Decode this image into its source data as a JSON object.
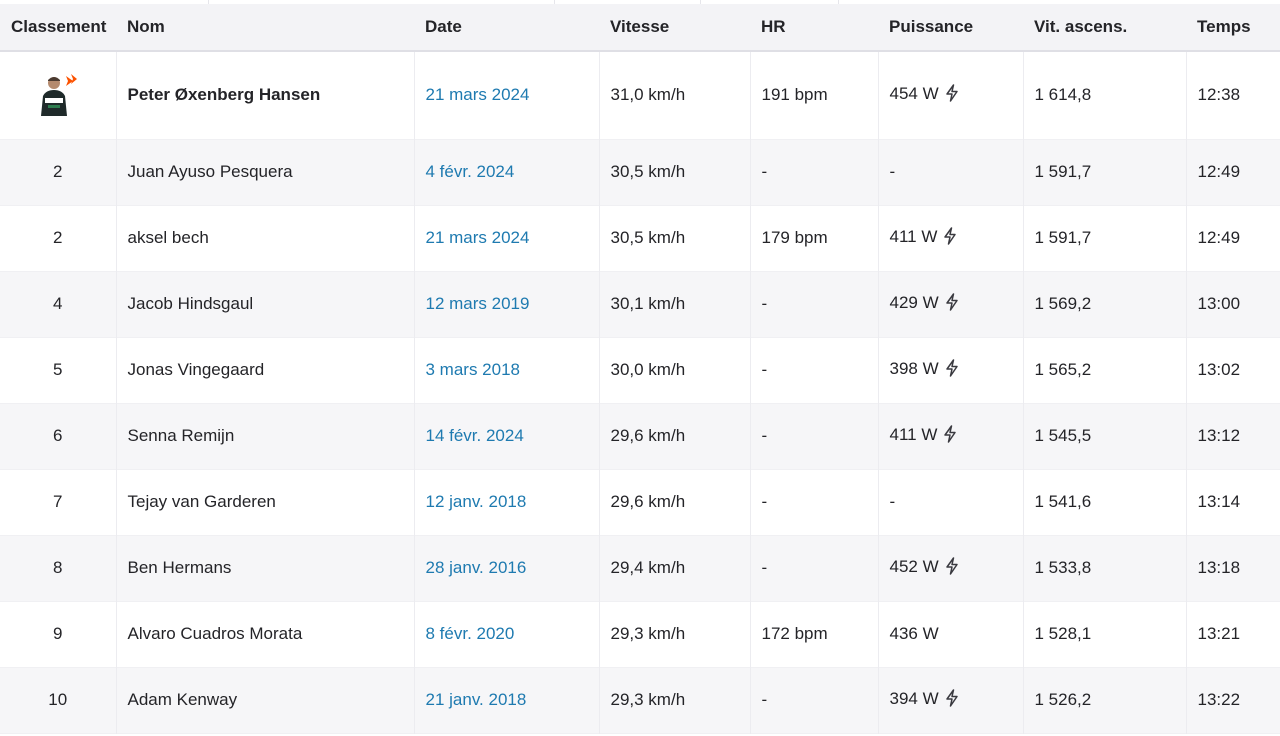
{
  "colors": {
    "date_link": "#1e7ab0",
    "header_bg": "#f3f3f6",
    "stripe_bg": "#f6f6f8",
    "brand": "#fc5200"
  },
  "columns": {
    "rank": "Classement",
    "name": "Nom",
    "date": "Date",
    "speed": "Vitesse",
    "hr": "HR",
    "power": "Puissance",
    "vam": "Vit. ascens.",
    "time": "Temps"
  },
  "rows": [
    {
      "rank": "",
      "avatar": true,
      "name": "Peter Øxenberg Hansen",
      "date": "21 mars 2024",
      "speed": "31,0 km/h",
      "hr": "191 bpm",
      "power": "454 W",
      "power_meter": true,
      "vam": "1 614,8",
      "time": "12:38"
    },
    {
      "rank": "2",
      "name": "Juan Ayuso Pesquera",
      "date": "4 févr. 2024",
      "speed": "30,5 km/h",
      "hr": "-",
      "power": "-",
      "power_meter": false,
      "vam": "1 591,7",
      "time": "12:49"
    },
    {
      "rank": "2",
      "name": "aksel bech",
      "date": "21 mars 2024",
      "speed": "30,5 km/h",
      "hr": "179 bpm",
      "power": "411 W",
      "power_meter": true,
      "vam": "1 591,7",
      "time": "12:49"
    },
    {
      "rank": "4",
      "name": "Jacob Hindsgaul",
      "date": "12 mars 2019",
      "speed": "30,1 km/h",
      "hr": "-",
      "power": "429 W",
      "power_meter": true,
      "vam": "1 569,2",
      "time": "13:00"
    },
    {
      "rank": "5",
      "name": "Jonas Vingegaard",
      "date": "3 mars 2018",
      "speed": "30,0 km/h",
      "hr": "-",
      "power": "398 W",
      "power_meter": true,
      "vam": "1 565,2",
      "time": "13:02"
    },
    {
      "rank": "6",
      "name": "Senna Remijn",
      "date": "14 févr. 2024",
      "speed": "29,6 km/h",
      "hr": "-",
      "power": "411 W",
      "power_meter": true,
      "vam": "1 545,5",
      "time": "13:12"
    },
    {
      "rank": "7",
      "name": "Tejay van Garderen",
      "date": "12 janv. 2018",
      "speed": "29,6 km/h",
      "hr": "-",
      "power": "-",
      "power_meter": false,
      "vam": "1 541,6",
      "time": "13:14"
    },
    {
      "rank": "8",
      "name": "Ben Hermans",
      "date": "28 janv. 2016",
      "speed": "29,4 km/h",
      "hr": "-",
      "power": "452 W",
      "power_meter": true,
      "vam": "1 533,8",
      "time": "13:18"
    },
    {
      "rank": "9",
      "name": "Alvaro Cuadros Morata",
      "date": "8 févr. 2020",
      "speed": "29,3 km/h",
      "hr": "172 bpm",
      "power": "436 W",
      "power_meter": false,
      "vam": "1 528,1",
      "time": "13:21"
    },
    {
      "rank": "10",
      "name": "Adam Kenway",
      "date": "21 janv. 2018",
      "speed": "29,3 km/h",
      "hr": "-",
      "power": "394 W",
      "power_meter": true,
      "vam": "1 526,2",
      "time": "13:22"
    }
  ]
}
